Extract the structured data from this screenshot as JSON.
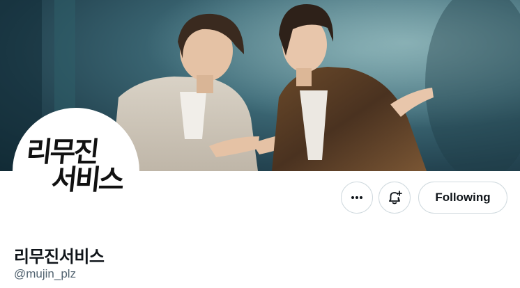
{
  "profile": {
    "banner_alt": "Two people posing in front of a teal backdrop",
    "avatar_line1": "리무진",
    "avatar_line2": "서비스",
    "display_name": "리무진서비스",
    "handle": "@mujin_plz"
  },
  "actions": {
    "more_icon": "more-dots-icon",
    "notify_icon": "bell-plus-icon",
    "follow_label": "Following"
  },
  "colors": {
    "border": "#cfd9de",
    "text_primary": "#0f1419",
    "text_secondary": "#536471"
  }
}
